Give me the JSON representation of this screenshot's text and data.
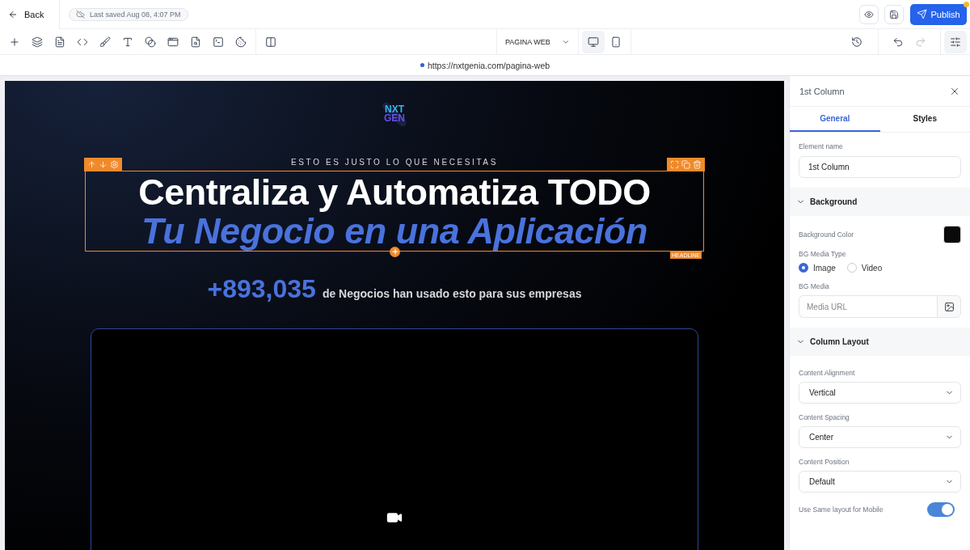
{
  "header": {
    "back": "Back",
    "save_status": "Last saved Aug 08, 4:07 PM",
    "publish": "Publish"
  },
  "toolbar": {
    "page_select": "PAGINA WEB",
    "devices": [
      {
        "kind": "desktop",
        "selected": true
      },
      {
        "kind": "mobile",
        "selected": false
      }
    ],
    "undo": {
      "disabled": false
    },
    "redo": {
      "disabled": true
    },
    "panel_toggle": {
      "selected": true
    }
  },
  "url": "https://nxtgenia.com/pagina-web",
  "canvas": {
    "logo": [
      "NXT",
      "GEN"
    ],
    "eyebrow": "ESTO ES JUSTO LO QUE NECESITAS",
    "headline_1": "Centraliza y Automatiza TODO",
    "headline_2": "Tu Negocio en una Aplicación",
    "selection_label": "HEADLINE",
    "stat_number": "+893,035",
    "stat_text": "de Negocios han usado esto para sus empresas"
  },
  "panel": {
    "title": "1st Column",
    "tabs": [
      {
        "label": "General",
        "selected": true
      },
      {
        "label": "Styles",
        "selected": false
      }
    ],
    "element_name": {
      "label": "Element name",
      "value": "1st Column"
    },
    "background": {
      "title": "Background",
      "expanded": true,
      "color_label": "Background Color",
      "color": "#0a0a0a",
      "media_type_label": "BG Media Type",
      "media_types": [
        {
          "label": "Image",
          "selected": true
        },
        {
          "label": "Video",
          "selected": false
        }
      ],
      "media_label": "BG Media",
      "media_placeholder": "Media URL"
    },
    "layout": {
      "title": "Column Layout",
      "expanded": true,
      "selects": [
        {
          "label": "Content Alignment",
          "value": "Vertical"
        },
        {
          "label": "Content Spacing",
          "value": "Center"
        },
        {
          "label": "Content Position",
          "value": "Default"
        }
      ],
      "mobile_toggle": {
        "label": "Use Same layout for Mobile",
        "on": true
      }
    }
  }
}
